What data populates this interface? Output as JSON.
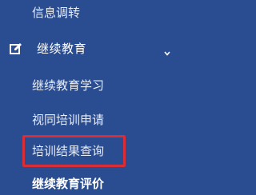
{
  "sidebar": {
    "top_item": {
      "label": "信息调转"
    },
    "section": {
      "label": "继续教育",
      "icon": "edit-icon",
      "expanded": true
    },
    "sub_items": [
      {
        "label": "继续教育学习"
      },
      {
        "label": "视同培训申请"
      },
      {
        "label": "培训结果查询",
        "highlighted": true
      },
      {
        "label": "继续教育评价"
      }
    ]
  },
  "colors": {
    "background": "#2a4c91",
    "text": "#ffffff",
    "highlight_border": "#d92d37"
  }
}
